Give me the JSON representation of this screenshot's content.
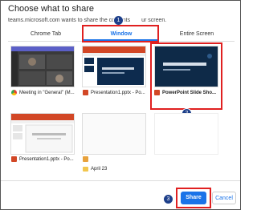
{
  "dialog": {
    "title": "Choose what to share",
    "subtitle_part1": "teams.microsoft.com wants to share the contents",
    "subtitle_part2": "ur screen."
  },
  "tabs": [
    {
      "label": "Chrome Tab"
    },
    {
      "label": "Window"
    },
    {
      "label": "Entire Screen"
    }
  ],
  "windows": [
    {
      "label": "Meeting in \"General\" (M...",
      "icon": "chrome-icon"
    },
    {
      "label": "Presentation1.pptx - Po...",
      "icon": "powerpoint-icon"
    },
    {
      "label": "PowerPoint Slide Sho...",
      "icon": "powerpoint-icon"
    },
    {
      "label": "Presentation1.pptx - Po...",
      "icon": "powerpoint-icon"
    },
    {
      "label": "",
      "icon": "generic-window-icon"
    },
    {
      "label": "April 23",
      "icon": "folder-icon"
    }
  ],
  "buttons": {
    "share": "Share",
    "cancel": "Cancel"
  },
  "steps": [
    "1",
    "2",
    "3"
  ],
  "colors": {
    "accent": "#1a73e8",
    "annotation_red": "#e02020",
    "step_badge": "#1d3f8a"
  }
}
